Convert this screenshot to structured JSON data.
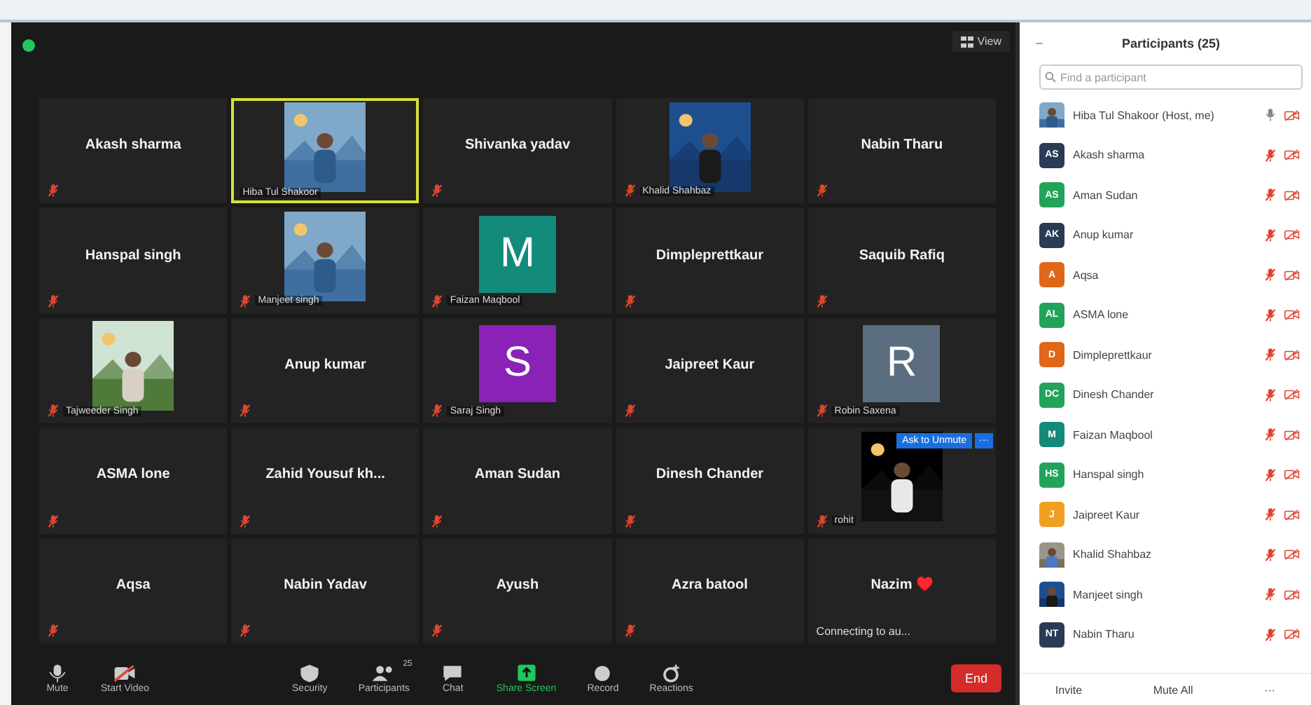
{
  "top_bar": {
    "view_button": "View"
  },
  "tiles": [
    {
      "kind": "name",
      "name": "Akash sharma",
      "muted": true,
      "speaking": false
    },
    {
      "kind": "picture",
      "label": "Hiba Tul Shakoor",
      "muted": false,
      "speaking": true
    },
    {
      "kind": "name",
      "name": "Shivanka yadav",
      "muted": true,
      "speaking": false
    },
    {
      "kind": "picture",
      "label": "Khalid Shahbaz",
      "muted": true,
      "speaking": false
    },
    {
      "kind": "name",
      "name": "Nabin Tharu",
      "muted": true,
      "speaking": false
    },
    {
      "kind": "name",
      "name": "Hanspal singh",
      "muted": true,
      "speaking": false
    },
    {
      "kind": "picture",
      "label": "Manjeet singh",
      "muted": true,
      "speaking": false
    },
    {
      "kind": "avatar",
      "letter": "M",
      "color": "#138a7a",
      "label": "Faizan Maqbool",
      "muted": true,
      "speaking": false
    },
    {
      "kind": "name",
      "name": "Dimpleprettkaur",
      "muted": true,
      "speaking": false
    },
    {
      "kind": "name",
      "name": "Saquib Rafiq",
      "muted": true,
      "speaking": false
    },
    {
      "kind": "picture",
      "label": "Tajweeder Singh",
      "muted": true,
      "speaking": false
    },
    {
      "kind": "name",
      "name": "Anup kumar",
      "muted": true,
      "speaking": false
    },
    {
      "kind": "avatar",
      "letter": "S",
      "color": "#8a22b8",
      "label": "Saraj Singh",
      "muted": true,
      "speaking": false
    },
    {
      "kind": "name",
      "name": "Jaipreet Kaur",
      "muted": true,
      "speaking": false
    },
    {
      "kind": "avatar",
      "letter": "R",
      "color": "#5b6e80",
      "label": "Robin Saxena",
      "muted": true,
      "speaking": false
    },
    {
      "kind": "name",
      "name": "ASMA lone",
      "muted": true,
      "speaking": false
    },
    {
      "kind": "name",
      "name": "Zahid Yousuf kh...",
      "muted": true,
      "speaking": false
    },
    {
      "kind": "name",
      "name": "Aman Sudan",
      "muted": true,
      "speaking": false
    },
    {
      "kind": "name",
      "name": "Dinesh Chander",
      "muted": true,
      "speaking": false
    },
    {
      "kind": "picture",
      "label": "rohit",
      "muted": true,
      "speaking": false,
      "overlay_button": "Ask to Unmute",
      "overlay_more": "···"
    },
    {
      "kind": "name",
      "name": "Aqsa",
      "muted": true,
      "speaking": false
    },
    {
      "kind": "name",
      "name": "Nabin Yadav",
      "muted": true,
      "speaking": false
    },
    {
      "kind": "name",
      "name": "Ayush",
      "muted": true,
      "speaking": false
    },
    {
      "kind": "name",
      "name": "Azra batool",
      "muted": true,
      "speaking": false
    },
    {
      "kind": "name",
      "name": "Nazim ♥️",
      "muted": false,
      "speaking": false,
      "status": "Connecting to au..."
    }
  ],
  "toolbar": [
    {
      "kind": "mic",
      "label": "Mute"
    },
    {
      "kind": "video",
      "label": "Start Video"
    },
    {
      "kind": "security",
      "label": "Security"
    },
    {
      "kind": "participants",
      "label": "Participants",
      "count": "25"
    },
    {
      "kind": "chat",
      "label": "Chat"
    },
    {
      "kind": "share",
      "label": "Share Screen"
    },
    {
      "kind": "record",
      "label": "Record"
    },
    {
      "kind": "reactions",
      "label": "Reactions"
    }
  ],
  "end_button": "End",
  "panel": {
    "title": "Participants (25)",
    "search": {
      "placeholder": "Find a participant"
    },
    "participants": [
      {
        "kind": "picture",
        "name": "Hiba Tul Shakoor (Host, me)",
        "muted": false
      },
      {
        "kind": "initials",
        "initials": "AS",
        "color": "#2b3a55",
        "name": "Akash sharma",
        "muted": true
      },
      {
        "kind": "initials",
        "initials": "AS",
        "color": "#22a35a",
        "name": "Aman Sudan",
        "muted": true
      },
      {
        "kind": "initials",
        "initials": "AK",
        "color": "#2b3a55",
        "name": "Anup kumar",
        "muted": true
      },
      {
        "kind": "initials",
        "initials": "A",
        "color": "#e0661a",
        "name": "Aqsa",
        "muted": true
      },
      {
        "kind": "initials",
        "initials": "AL",
        "color": "#22a35a",
        "name": "ASMA lone",
        "muted": true
      },
      {
        "kind": "initials",
        "initials": "D",
        "color": "#e0661a",
        "name": "Dimpleprettkaur",
        "muted": true
      },
      {
        "kind": "initials",
        "initials": "DC",
        "color": "#22a35a",
        "name": "Dinesh Chander",
        "muted": true
      },
      {
        "kind": "initials",
        "initials": "M",
        "color": "#138a7a",
        "name": "Faizan Maqbool",
        "muted": true
      },
      {
        "kind": "initials",
        "initials": "HS",
        "color": "#22a35a",
        "name": "Hanspal singh",
        "muted": true
      },
      {
        "kind": "initials",
        "initials": "J",
        "color": "#f0a020",
        "name": "Jaipreet Kaur",
        "muted": true
      },
      {
        "kind": "picture",
        "name": "Khalid Shahbaz",
        "muted": true
      },
      {
        "kind": "picture",
        "name": "Manjeet singh",
        "muted": true
      },
      {
        "kind": "initials",
        "initials": "NT",
        "color": "#2b3a55",
        "name": "Nabin Tharu",
        "muted": true
      }
    ],
    "buttons": [
      "Invite",
      "Mute All",
      "···"
    ]
  }
}
